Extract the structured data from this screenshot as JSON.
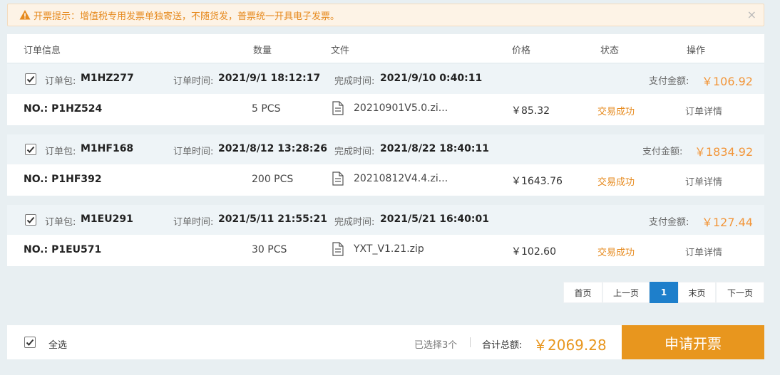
{
  "notice": {
    "text": "开票提示：增值税专用发票单独寄送，不随货发，普票统一开具电子发票。",
    "close": "×"
  },
  "header": {
    "order_info": "订单信息",
    "quantity": "数量",
    "file": "文件",
    "price": "价格",
    "status": "状态",
    "action": "操作"
  },
  "labels": {
    "package": "订单包:",
    "order_time": "订单时间:",
    "complete_time": "完成时间:",
    "paid_amount": "支付金额:"
  },
  "orders": [
    {
      "package": "M1HZ277",
      "order_time": "2021/9/1 18:12:17",
      "complete_time": "2021/9/10 0:40:11",
      "paid": "￥106.92",
      "no": "NO.: P1HZ524",
      "qty": "5 PCS",
      "file": "20210901V5.0.zi...",
      "price": "￥85.32",
      "status": "交易成功",
      "detail": "订单详情"
    },
    {
      "package": "M1HF168",
      "order_time": "2021/8/12 13:28:26",
      "complete_time": "2021/8/22 18:40:11",
      "paid": "￥1834.92",
      "no": "NO.: P1HF392",
      "qty": "200 PCS",
      "file": "20210812V4.4.zi...",
      "price": "￥1643.76",
      "status": "交易成功",
      "detail": "订单详情"
    },
    {
      "package": "M1EU291",
      "order_time": "2021/5/11 21:55:21",
      "complete_time": "2021/5/21 16:40:01",
      "paid": "￥127.44",
      "no": "NO.: P1EU571",
      "qty": "30 PCS",
      "file": "YXT_V1.21.zip",
      "price": "￥102.60",
      "status": "交易成功",
      "detail": "订单详情"
    }
  ],
  "pager": {
    "first": "首页",
    "prev": "上一页",
    "current": "1",
    "last": "末页",
    "next": "下一页"
  },
  "footer": {
    "select_all": "全选",
    "selected": "已选择3个",
    "total_label": "合计总额:",
    "total": "￥2069.28",
    "apply": "申请开票"
  },
  "colors": {
    "accent": "#e8961e",
    "price": "#f2963a",
    "page_active": "#1e7fcb"
  }
}
